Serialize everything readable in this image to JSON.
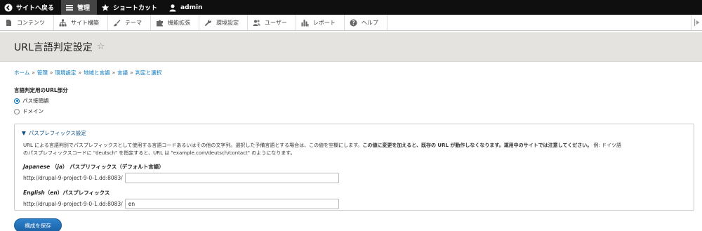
{
  "toolbar": {
    "back_label": "サイトへ戻る",
    "manage_label": "管理",
    "shortcuts_label": "ショートカット",
    "user_label": "admin"
  },
  "menu": {
    "items": [
      {
        "label": "コンテンツ",
        "icon": "file-icon"
      },
      {
        "label": "サイト構築",
        "icon": "sitemap-icon"
      },
      {
        "label": "テーマ",
        "icon": "paintbrush-icon"
      },
      {
        "label": "機能拡張",
        "icon": "puzzle-icon"
      },
      {
        "label": "環境設定",
        "icon": "wrench-icon"
      },
      {
        "label": "ユーザー",
        "icon": "people-icon"
      },
      {
        "label": "レポート",
        "icon": "bar-chart-icon"
      },
      {
        "label": "ヘルプ",
        "icon": "help-icon"
      }
    ]
  },
  "page": {
    "title": "URL言語判定設定",
    "breadcrumb": [
      "ホーム",
      "管理",
      "環境設定",
      "地域と言語",
      "言語",
      "判定と選択"
    ]
  },
  "form": {
    "part_label": "言語判定用のURL部分",
    "options": [
      "パス接頭語",
      "ドメイン"
    ],
    "selected": "パス接頭語",
    "details": {
      "summary": "パスプレフィックス設定",
      "description_1": "URL による言語判別でパスプレフィックスとして使用する言語コードあるいはその他の文字列。選択した予備言語とする場合は、この値を空欄にします。",
      "description_bold": "この値に変更を加えると、既存の URL が動作しなくなります。運用中のサイトでは注意してください。",
      "description_2": " 例: ドイツ語",
      "description_3": "のパスプレフィックスコードに \"deutsch\" を指定すると、URL は \"example.com/deutsch/contact\" のようになります。",
      "fields": [
        {
          "lang": "Japanese",
          "code": "ja",
          "label_suffix": "パスプリフィックス（デフォルト言語）",
          "prefix": "http://drupal-9-project-9-0-1.dd:8083/",
          "value": ""
        },
        {
          "lang": "English",
          "code": "en",
          "label_suffix": "パスプレフィックス",
          "prefix": "http://drupal-9-project-9-0-1.dd:8083/",
          "value": "en"
        }
      ]
    },
    "save_label": "構成を保存"
  }
}
